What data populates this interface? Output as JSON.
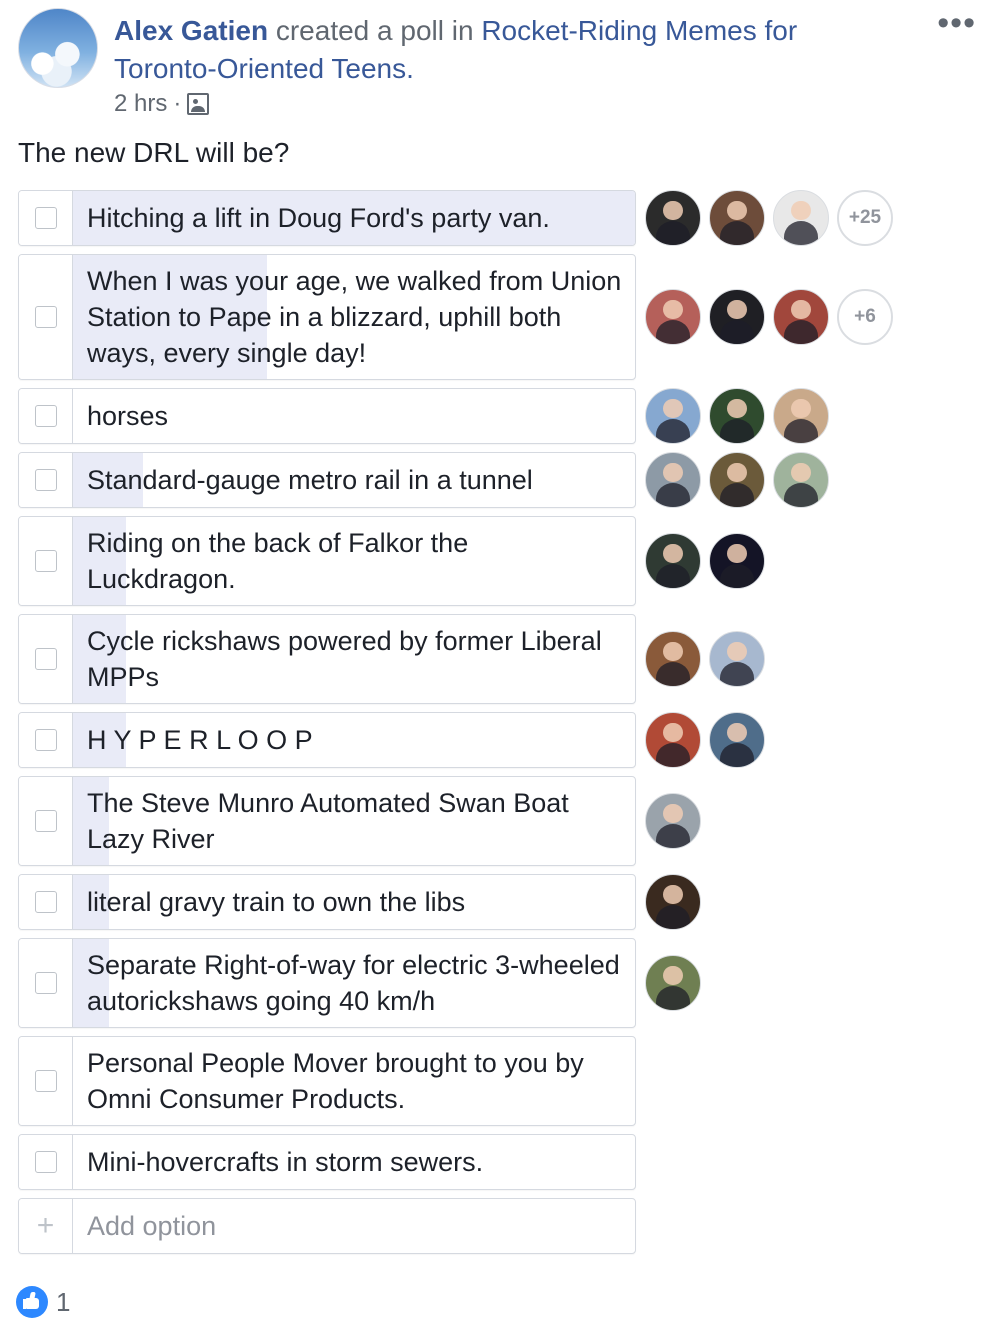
{
  "post": {
    "author": "Alex Gatien",
    "action": "created a poll in",
    "group": "Rocket-Riding Memes for Toronto-Oriented Teens.",
    "time": "2 hrs",
    "separator": "·",
    "audience_icon": "group-members-icon",
    "more_icon": "•••",
    "question": "The new DRL will be?"
  },
  "poll": {
    "options": [
      {
        "label": "Hitching a lift in Doug Ford's party van.",
        "vote_fraction": 1.0,
        "more_voters": "+25",
        "voters": 3
      },
      {
        "label": "When I was your age, we walked from Union Station to Pape in a blizzard, uphill both ways, every single day!",
        "vote_fraction": 0.32,
        "more_voters": "+6",
        "voters": 3
      },
      {
        "label": "horses",
        "vote_fraction": 0.0,
        "voters": 3
      },
      {
        "label": "Standard-gauge metro rail in a tunnel",
        "vote_fraction": 0.1,
        "voters": 3
      },
      {
        "label": "Riding on the back of Falkor the Luckdragon.",
        "vote_fraction": 0.07,
        "voters": 2
      },
      {
        "label": "Cycle rickshaws powered by former Liberal MPPs",
        "vote_fraction": 0.07,
        "voters": 2
      },
      {
        "label": "H Y P E R L O O P",
        "vote_fraction": 0.07,
        "voters": 2
      },
      {
        "label": "The Steve Munro Automated Swan Boat Lazy River",
        "vote_fraction": 0.04,
        "voters": 1
      },
      {
        "label": "literal gravy train to own the libs",
        "vote_fraction": 0.04,
        "voters": 1
      },
      {
        "label": "Separate Right-of-way for electric 3-wheeled autorickshaws going 40 km/h",
        "vote_fraction": 0.04,
        "voters": 1
      },
      {
        "label": "Personal People Mover brought to you by Omni Consumer Products.",
        "vote_fraction": 0.0,
        "voters": 0
      },
      {
        "label": "Mini-hovercrafts in storm sewers.",
        "vote_fraction": 0.0,
        "voters": 0
      }
    ],
    "add_option": {
      "icon": "+",
      "label": "Add option"
    }
  },
  "reactions": {
    "icon": "like-icon",
    "count": "1"
  },
  "colors": {
    "link": "#385898",
    "vote_fill": "#e9ebf7",
    "like_blue": "#2d88ff",
    "voter_backgrounds": [
      [
        "#2b2b2b",
        "#6d4c3a",
        "#e8e8e8"
      ],
      [
        "#b5605a",
        "#1f1f24",
        "#a1473c"
      ],
      [
        "#86a8d0",
        "#2f4b2e",
        "#c9a98a"
      ],
      [
        "#8d9aa6",
        "#6b5a3a",
        "#9fb39c"
      ],
      [
        "#2f3a33",
        "#141426"
      ],
      [
        "#8a5a3a",
        "#a7b8cf"
      ],
      [
        "#b14a36",
        "#4f6d8a"
      ],
      [
        "#9aa3ab"
      ],
      [
        "#3a2a1f"
      ],
      [
        "#6f7f52"
      ]
    ]
  }
}
